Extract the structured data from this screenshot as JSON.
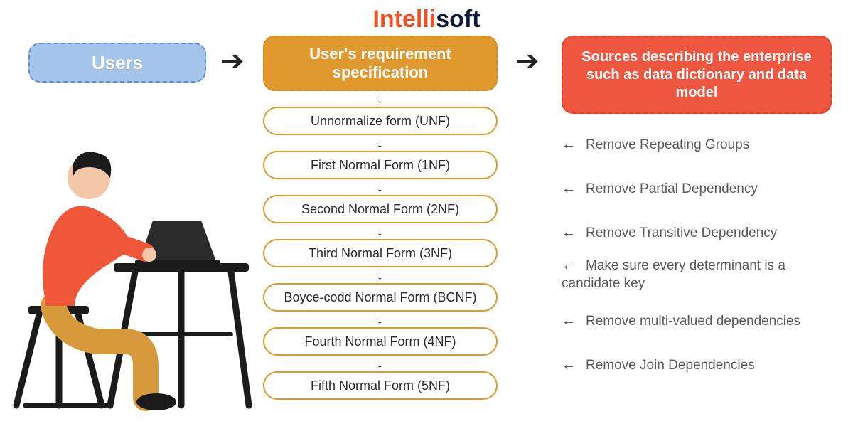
{
  "logo": {
    "part1": "Intelli",
    "part2": "soft"
  },
  "top": {
    "users": "Users",
    "req": "User's requirement specification",
    "sources": "Sources describing the enterprise such as data dictionary and data model"
  },
  "forms": [
    "Unnormalize form (UNF)",
    "First Normal Form (1NF)",
    "Second Normal Form (2NF)",
    "Third Normal Form (3NF)",
    "Boyce-codd Normal Form (BCNF)",
    "Fourth Normal Form (4NF)",
    "Fifth Normal Form (5NF)"
  ],
  "annotations": [
    "Remove Repeating Groups",
    "Remove Partial Dependency",
    "Remove Transitive Dependency",
    "Make sure every determinant is a candidate key",
    "Remove multi-valued dependencies",
    "Remove Join Dependencies"
  ]
}
